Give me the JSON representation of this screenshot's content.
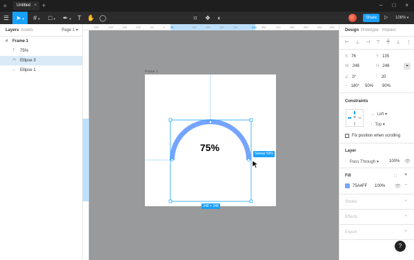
{
  "tab": {
    "title": "Untitled",
    "close": "×",
    "new": "+"
  },
  "window": {
    "minimize": "–",
    "maximize": "□",
    "close": "×"
  },
  "toolbar": {
    "menu_icon": "hamburger-icon",
    "tools": [
      "move-tool",
      "frame-tool",
      "shape-tool",
      "pen-tool",
      "text-tool",
      "hand-tool",
      "comment-tool"
    ],
    "share_label": "Share",
    "zoom_label": "106%",
    "accent": "#18A0FB"
  },
  "left_panel": {
    "tabs": [
      "Layers",
      "Assets"
    ],
    "page_label": "Page 1",
    "layers": [
      {
        "name": "Frame 1",
        "icon": "frame-icon"
      },
      {
        "name": "75%",
        "icon": "text-icon"
      },
      {
        "name": "Ellipse 3",
        "icon": "arc-icon",
        "selected": true
      },
      {
        "name": "Ellipse 1",
        "icon": "ellipse-icon"
      }
    ]
  },
  "rulers": {
    "top": [
      "-250",
      "-200",
      "-150",
      "-100",
      "-50",
      "0",
      "50",
      "76",
      "100",
      "150",
      "200",
      "250",
      "324",
      "350",
      "400",
      "450",
      "500",
      "550",
      "600"
    ],
    "left": [
      "-100",
      "-50",
      "0",
      "50",
      "100",
      "135",
      "200",
      "250",
      "300",
      "383",
      "400"
    ]
  },
  "canvas": {
    "frame_label": "Frame 1",
    "text": "75%",
    "sweep_label": "Sweep 50%",
    "size_label": "248 × 248",
    "arc_color": "#75A4FF",
    "selection_color": "#18A0FB"
  },
  "right_panel": {
    "tabs": [
      "Design",
      "Prototype",
      "Inspect"
    ],
    "x_label": "X",
    "x_value": "76",
    "y_label": "Y",
    "y_value": "135",
    "w_label": "W",
    "w_value": "248",
    "h_label": "H",
    "h_value": "248",
    "rotation": "0°",
    "corner": "20",
    "arc_start": "180°",
    "arc_sweep": "50%",
    "arc_ratio": "90%",
    "constraints_title": "Constraints",
    "constraint_h": "Left",
    "constraint_v": "Top",
    "fix_position": "Fix position when scrolling",
    "layer_title": "Layer",
    "blend_mode": "Pass Through",
    "layer_opacity": "100%",
    "fill_title": "Fill",
    "fill_hex": "75A4FF",
    "fill_opacity": "100%",
    "fill_color": "#75A4FF",
    "stroke_title": "Stroke",
    "effects_title": "Effects",
    "export_title": "Export"
  },
  "help_label": "?"
}
